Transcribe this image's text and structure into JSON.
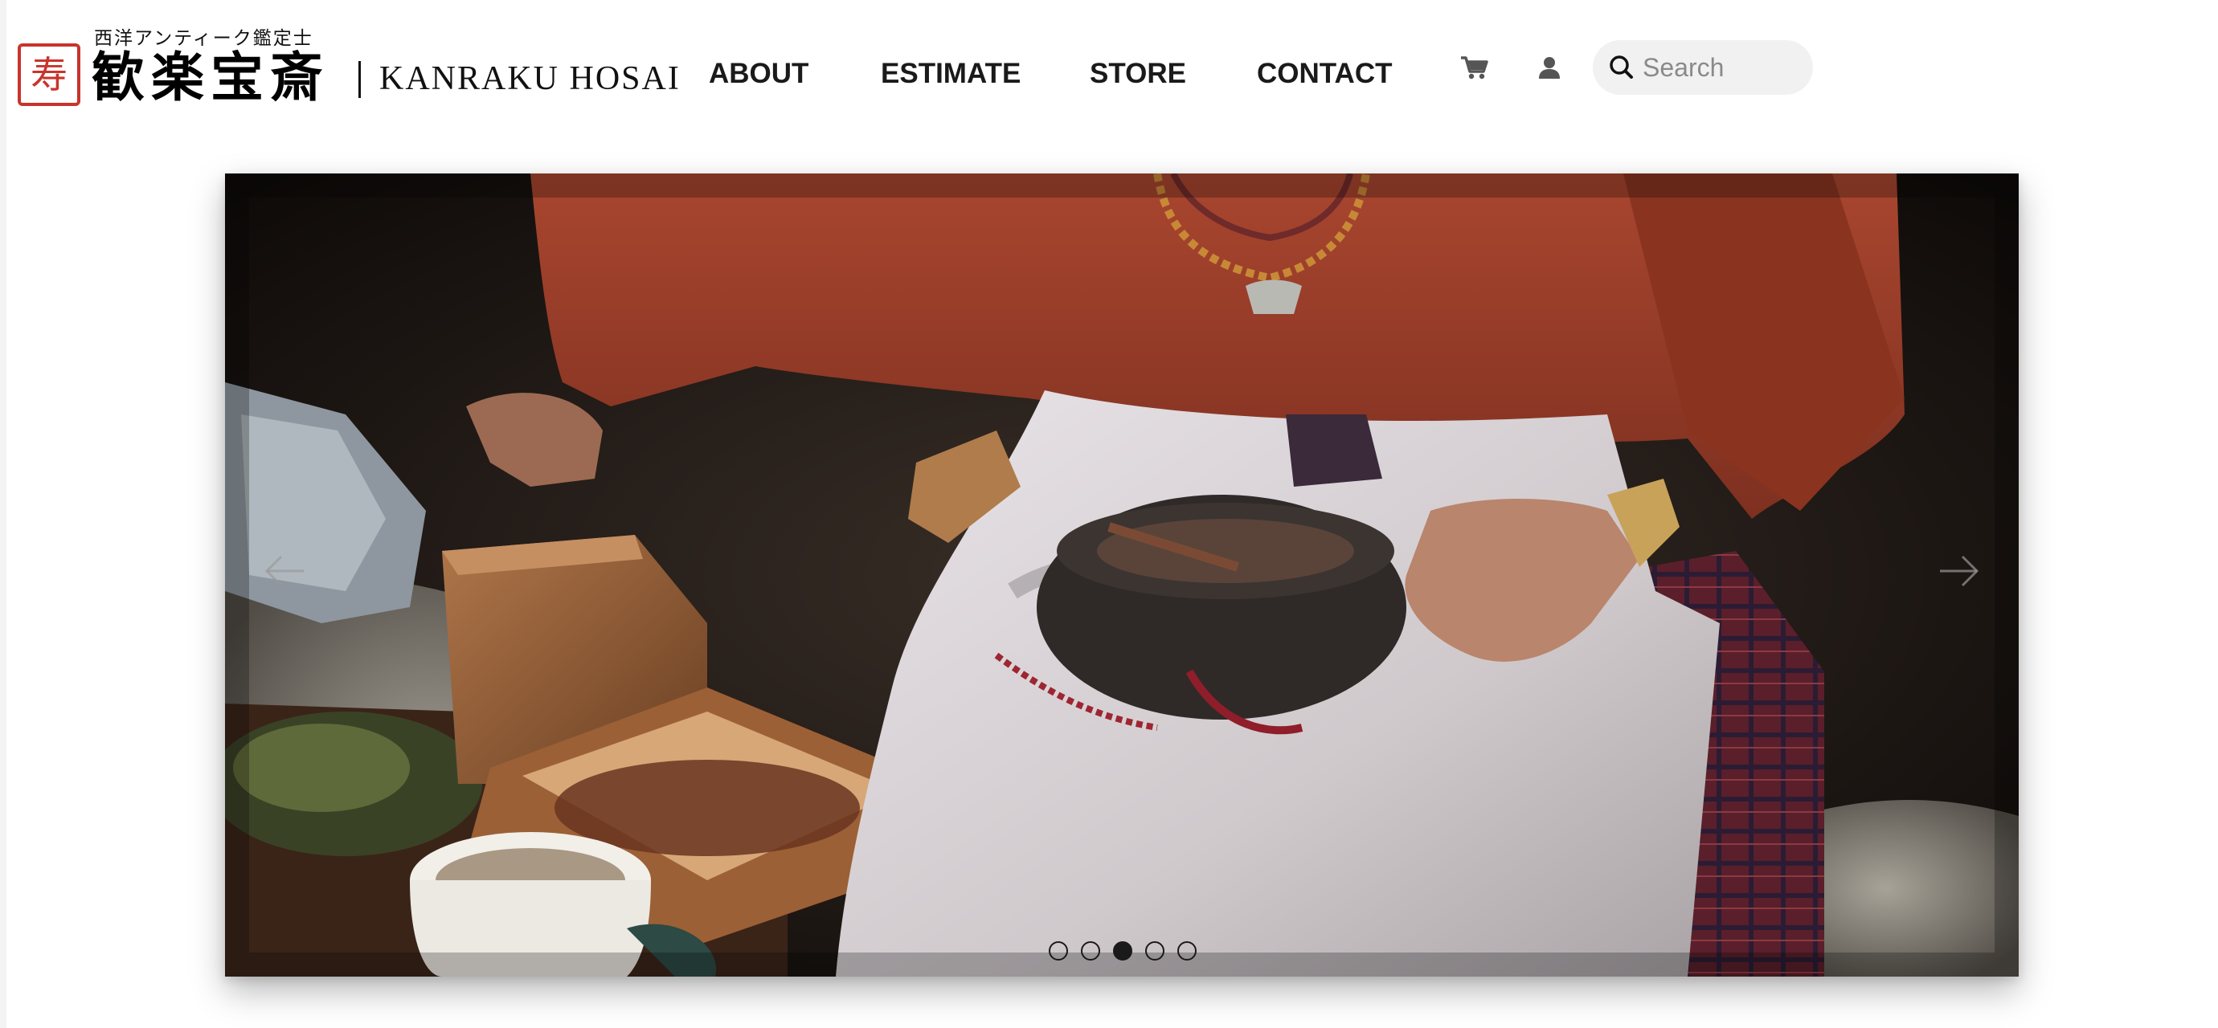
{
  "brand": {
    "subtitle": "西洋アンティーク鑑定士",
    "name_ja": "歓楽宝斎",
    "name_en": "KANRAKU HOSAI",
    "seal_icon": "red-seal-icon",
    "seal_glyph": "寿",
    "seal_color": "#c8342c"
  },
  "nav": {
    "items": [
      {
        "label": "ABOUT"
      },
      {
        "label": "ESTIMATE"
      },
      {
        "label": "STORE"
      },
      {
        "label": "CONTACT"
      }
    ]
  },
  "header_icons": {
    "cart": "cart-icon",
    "account": "user-icon"
  },
  "search": {
    "placeholder": "Search",
    "value": "",
    "icon": "search-icon"
  },
  "carousel": {
    "slide_count": 5,
    "active_slide": 3,
    "prev_icon": "arrow-left-icon",
    "next_icon": "arrow-right-icon"
  },
  "colors": {
    "accent_red": "#c8342c",
    "text": "#1a1a1a",
    "search_bg": "#f1f1f1"
  }
}
